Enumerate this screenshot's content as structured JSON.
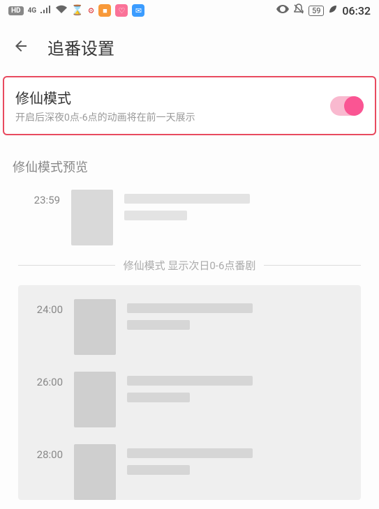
{
  "status_bar": {
    "hd_badge": "HD",
    "network_4g": "4G",
    "battery": "59",
    "time": "06:32"
  },
  "header": {
    "title": "追番设置"
  },
  "setting": {
    "title": "修仙模式",
    "description": "开启后深夜0点-6点的动画将在前一天展示"
  },
  "preview": {
    "section_label": "修仙模式预览",
    "divider_text": "修仙模式 显示次日0-6点番剧",
    "rows_before": [
      {
        "time": "23:59"
      }
    ],
    "rows_after": [
      {
        "time": "24:00"
      },
      {
        "time": "26:00"
      },
      {
        "time": "28:00"
      }
    ]
  }
}
